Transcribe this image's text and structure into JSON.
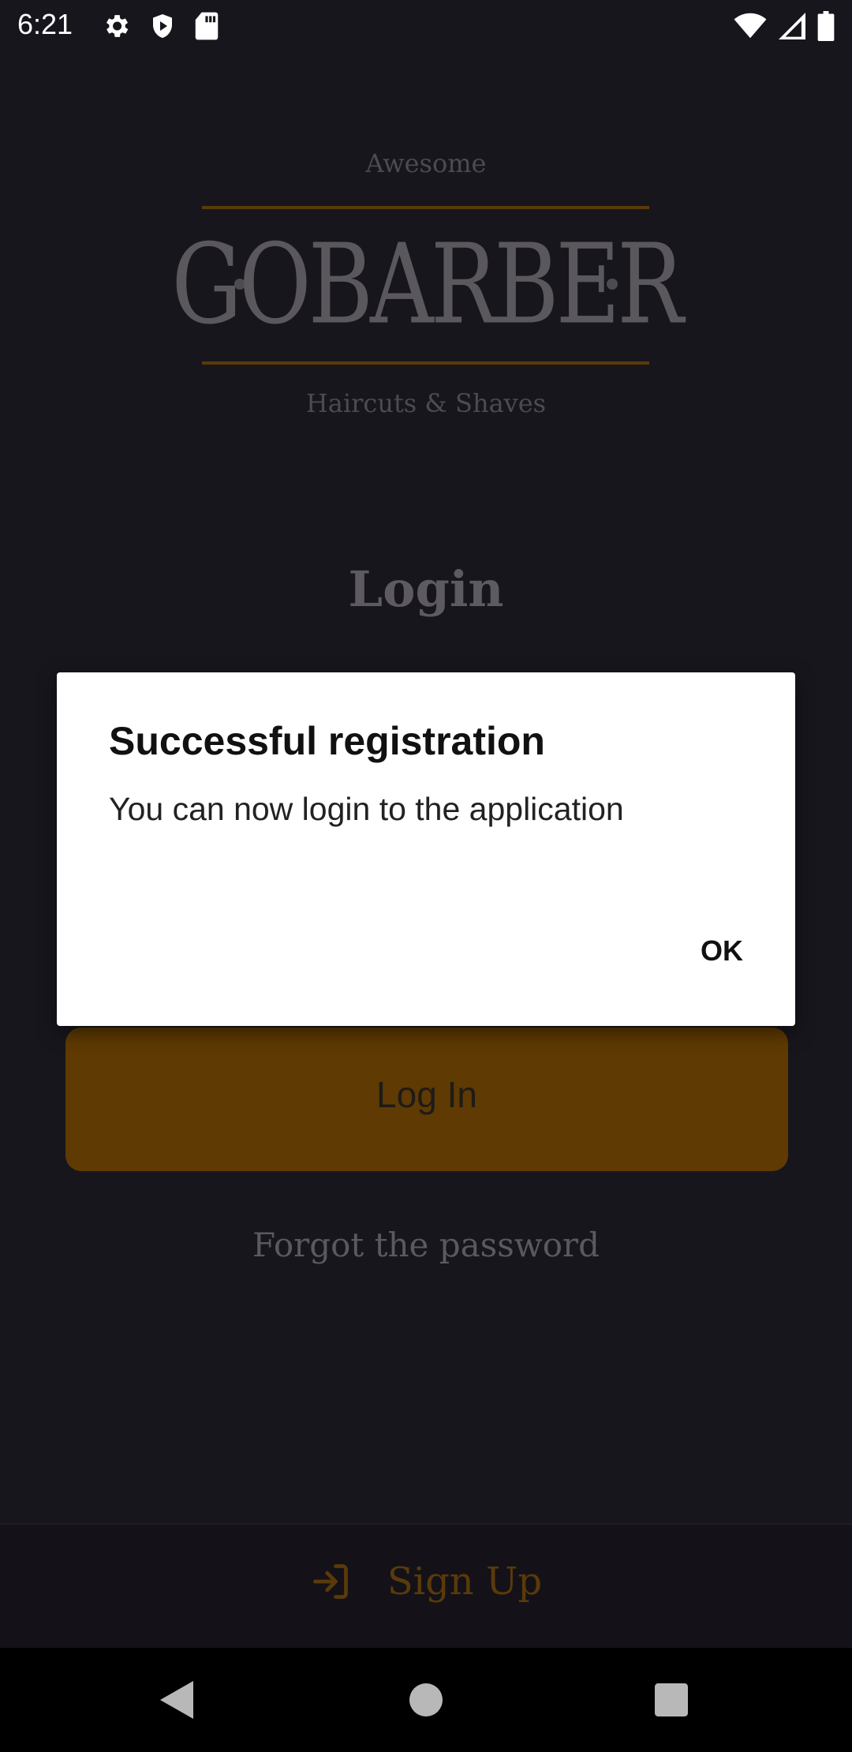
{
  "status_bar": {
    "time": "6:21",
    "left_icons": [
      "gear-icon",
      "shield-icon",
      "sd-card-icon"
    ],
    "right_icons": [
      "wifi-icon",
      "signal-icon",
      "battery-icon"
    ]
  },
  "logo": {
    "top": "Awesome",
    "main": "GOBARBER",
    "bottom": "Haircuts & Shaves"
  },
  "login": {
    "title": "Login",
    "button_label": "Log In",
    "forgot_label": "Forgot the password"
  },
  "signup": {
    "label": "Sign Up",
    "icon": "log-in-arrow-icon"
  },
  "dialog": {
    "title": "Successful registration",
    "message": "You can now login to the application",
    "ok_label": "OK"
  },
  "nav": {
    "icons": [
      "back-icon",
      "home-icon",
      "recents-icon"
    ]
  },
  "colors": {
    "background": "#18161d",
    "accent": "#ff9000",
    "dialog": "#ffffff"
  }
}
